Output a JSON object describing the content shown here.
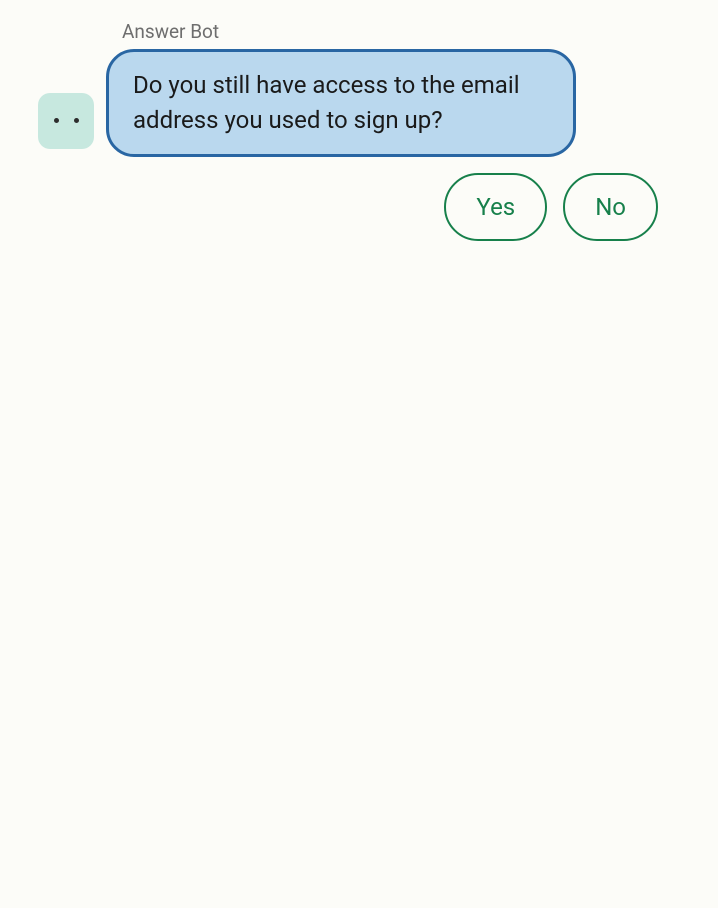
{
  "bot": {
    "name": "Answer Bot"
  },
  "message": {
    "text": "Do you still have access to the email address you used to sign up?"
  },
  "replies": {
    "yes": "Yes",
    "no": "No"
  }
}
